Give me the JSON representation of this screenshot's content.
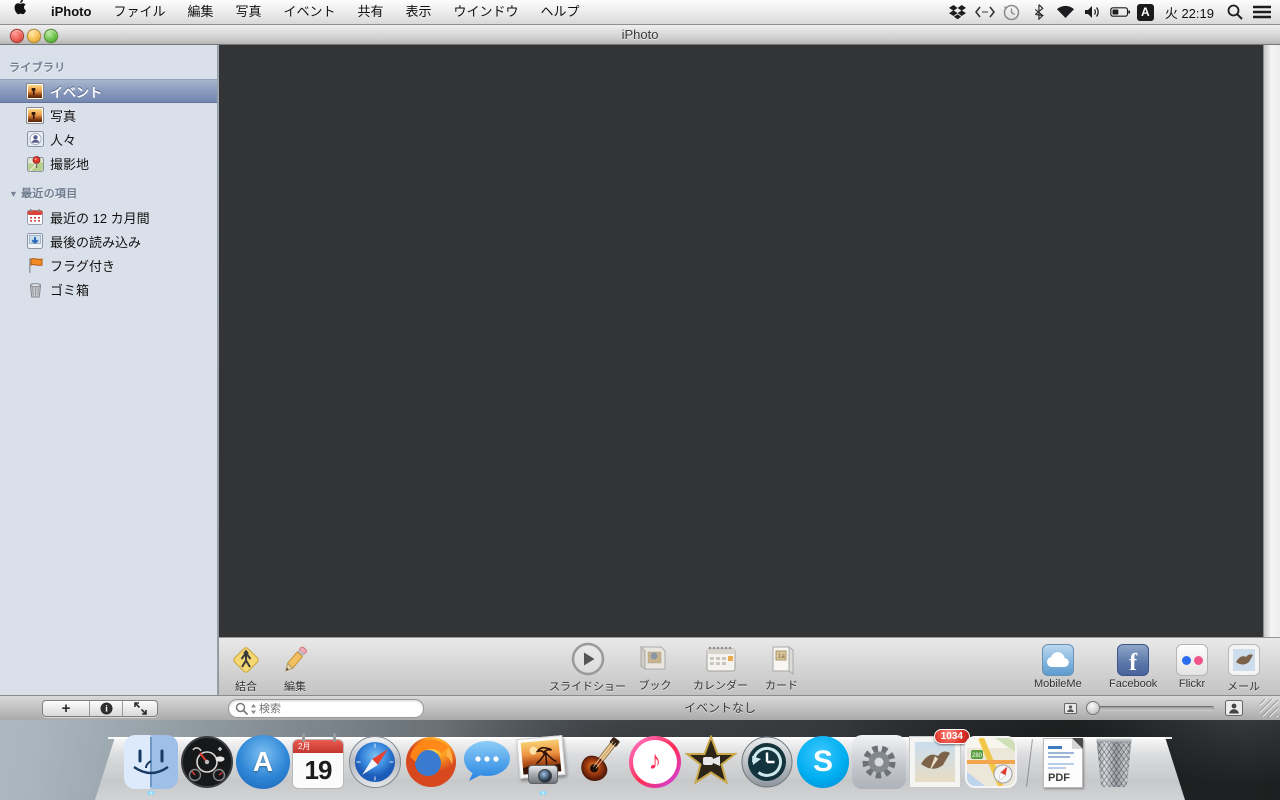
{
  "colors": {
    "selection_blue": "#8295ba",
    "content_bg": "#333436",
    "sidebar_bg": "#dae0ea",
    "badge_red": "#e0352b",
    "menubar_bg": "#f2f2f2"
  },
  "menu_bar": {
    "items": [
      "iPhoto",
      "ファイル",
      "編集",
      "写真",
      "イベント",
      "共有",
      "表示",
      "ウインドウ",
      "ヘルプ"
    ],
    "clock": "火 22:19",
    "input_source": "A",
    "status_icons": [
      "dropbox-icon",
      "swap-arrows-icon",
      "time-machine-icon",
      "bluetooth-icon",
      "wifi-icon",
      "volume-icon",
      "battery-icon",
      "input-source-badge",
      "clock-text",
      "spotlight-icon",
      "notification-center-icon"
    ]
  },
  "window": {
    "title": "iPhoto"
  },
  "sidebar": {
    "library_header": "ライブラリ",
    "library_items": [
      {
        "label": "イベント",
        "icon": "events-photo-icon",
        "selected": true
      },
      {
        "label": "写真",
        "icon": "photos-photo-icon",
        "selected": false
      },
      {
        "label": "人々",
        "icon": "faces-icon",
        "selected": false
      },
      {
        "label": "撮影地",
        "icon": "places-pin-icon",
        "selected": false
      }
    ],
    "recent_header": "最近の項目",
    "recent_items": [
      {
        "label": "最近の 12 カ月間",
        "icon": "calendar-icon"
      },
      {
        "label": "最後の読み込み",
        "icon": "last-import-icon"
      },
      {
        "label": "フラグ付き",
        "icon": "flag-icon"
      },
      {
        "label": "ゴミ箱",
        "icon": "trash-icon"
      }
    ]
  },
  "toolbar": {
    "items": [
      {
        "label": "結合",
        "icon": "merge-icon"
      },
      {
        "label": "編集",
        "icon": "edit-pencil-icon"
      },
      {
        "label": "スライドショー",
        "icon": "slideshow-play-icon"
      },
      {
        "label": "ブック",
        "icon": "book-icon"
      },
      {
        "label": "カレンダー",
        "icon": "calendar-pad-icon"
      },
      {
        "label": "カード",
        "icon": "card-icon"
      },
      {
        "label": "MobileMe",
        "icon": "mobileme-cloud-icon"
      },
      {
        "label": "Facebook",
        "icon": "facebook-icon",
        "letter": "f"
      },
      {
        "label": "Flickr",
        "icon": "flickr-icon"
      },
      {
        "label": "メール",
        "icon": "mail-stamp-icon"
      }
    ]
  },
  "bottom_bar": {
    "add_label": "+",
    "search_placeholder": "検索",
    "status": "イベントなし"
  },
  "dock": {
    "apps": [
      "finder",
      "dashboard",
      "app-store",
      "calendar",
      "safari",
      "firefox",
      "messages",
      "iphoto",
      "garageband",
      "itunes",
      "imovie",
      "time-machine",
      "skype",
      "system-preferences",
      "mail",
      "maps",
      "pdf-document",
      "trash"
    ],
    "app_store_letter": "A",
    "calendar_month": "2月",
    "calendar_day": "19",
    "skype_letter": "S",
    "facebook_letter": "f",
    "mail_badge": "1034",
    "maps_shield": "280",
    "pdf_label": "PDF"
  }
}
